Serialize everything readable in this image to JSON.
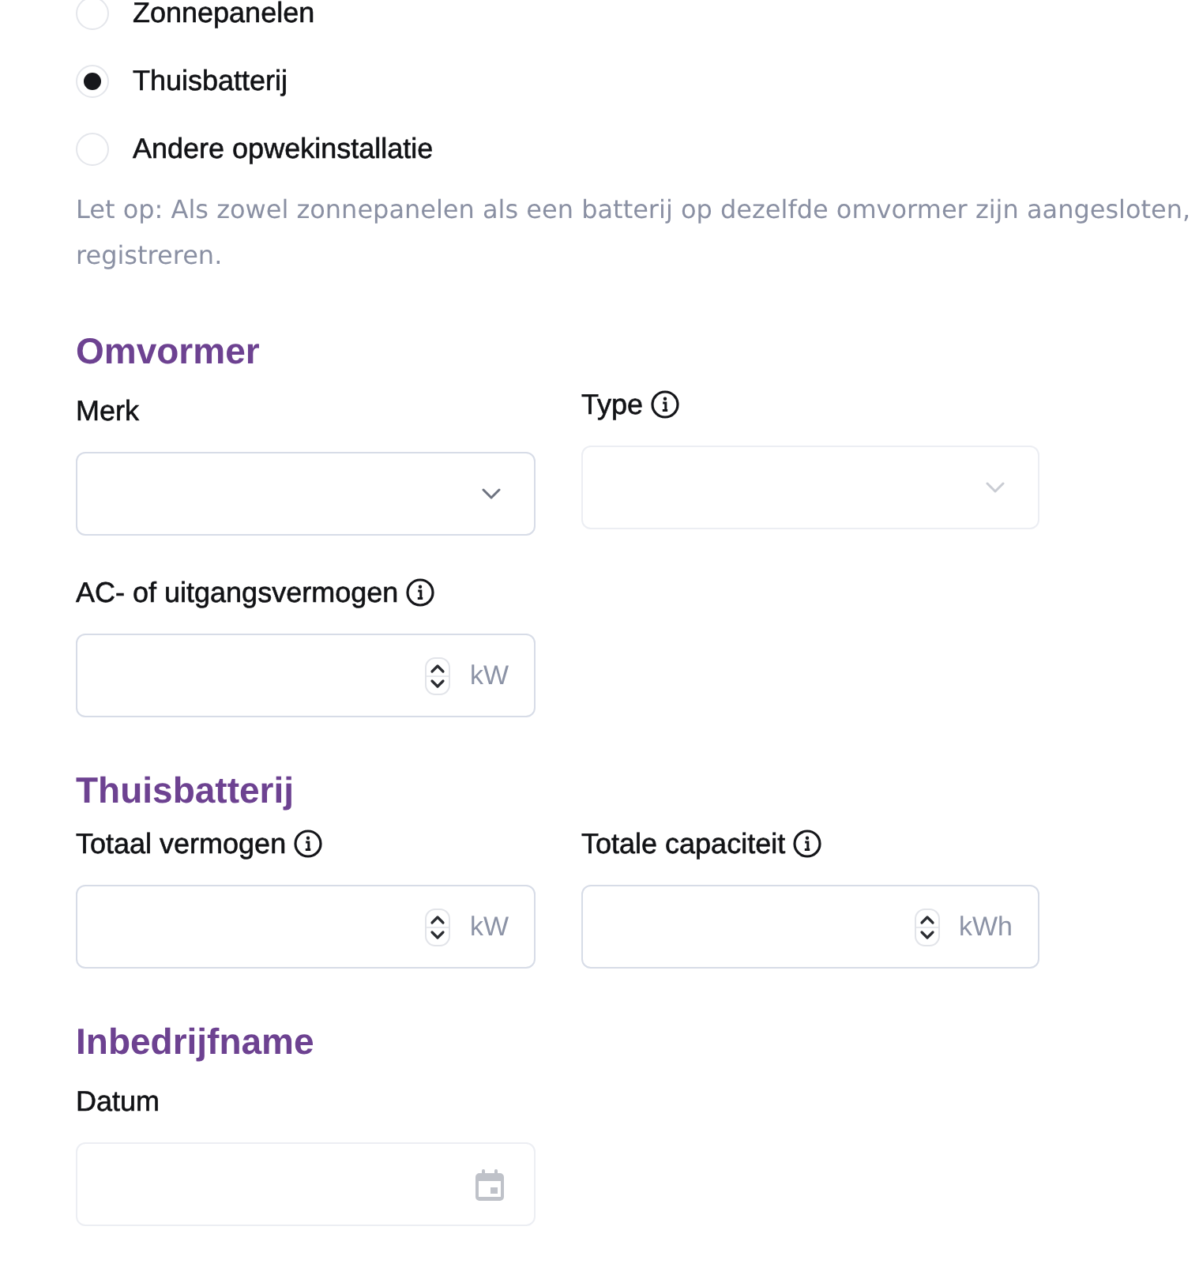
{
  "source_options": [
    {
      "label": "Zonnepanelen",
      "selected": false
    },
    {
      "label": "Thuisbatterij",
      "selected": true
    },
    {
      "label": "Andere opwekinstallatie",
      "selected": false
    }
  ],
  "note": {
    "lines": [
      "Let op: Als zowel zonnepanelen als een batterij op dezelfde omvormer zijn aangesloten,",
      "registreren."
    ]
  },
  "sections": [
    {
      "title": "Omvormer",
      "rows": [
        {
          "fields": [
            {
              "kind": "select",
              "label": "Merk",
              "info": false,
              "disabled": false
            },
            {
              "kind": "select",
              "label": "Type",
              "info": true,
              "disabled": true
            }
          ]
        },
        {
          "fields": [
            {
              "kind": "number",
              "label": "AC- of uitgangsvermogen",
              "info": true,
              "unit": "kW",
              "disabled": false
            }
          ]
        }
      ]
    },
    {
      "title": "Thuisbatterij",
      "rows": [
        {
          "fields": [
            {
              "kind": "number",
              "label": "Totaal vermogen",
              "info": true,
              "unit": "kW",
              "disabled": false
            },
            {
              "kind": "number",
              "label": "Totale capaciteit",
              "info": true,
              "unit": "kWh",
              "disabled": false
            }
          ]
        }
      ]
    },
    {
      "title": "Inbedrijfname",
      "rows": [
        {
          "fields": [
            {
              "kind": "date",
              "label": "Datum",
              "info": false,
              "disabled": true
            }
          ]
        }
      ]
    }
  ]
}
